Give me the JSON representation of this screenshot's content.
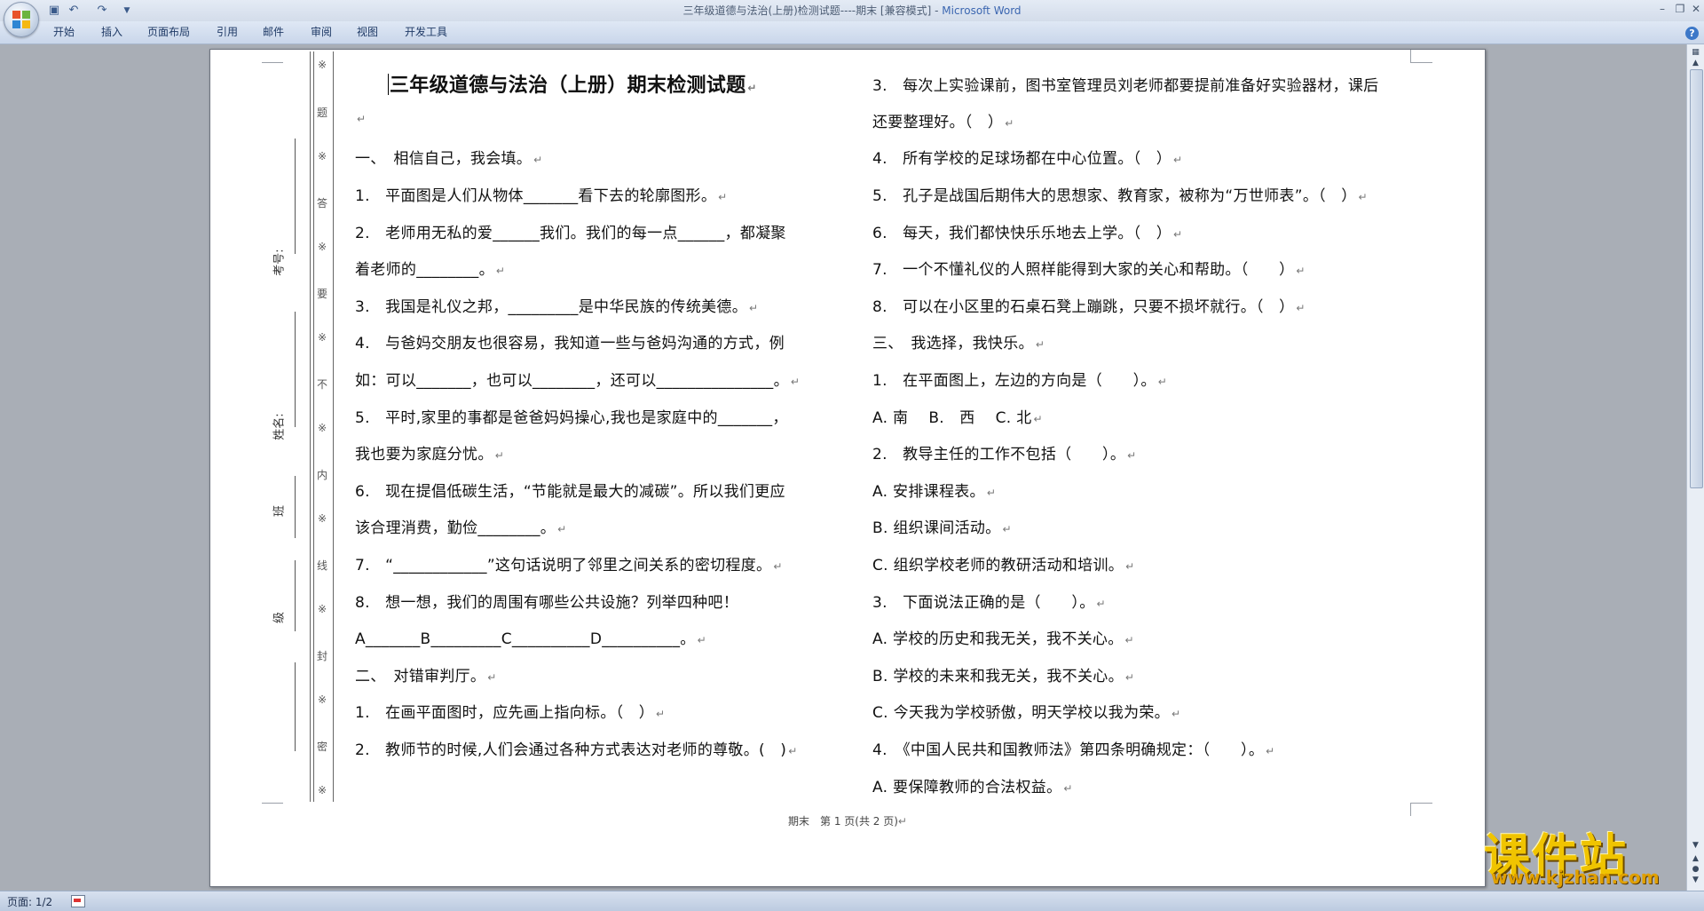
{
  "window": {
    "title": "三年级道德与法治(上册)检测试题----期末 [兼容模式] - ",
    "app_name": "Microsoft Word"
  },
  "quick_access": [
    "save-icon",
    "undo-icon",
    "redo-icon",
    "customize-icon"
  ],
  "ribbon": {
    "tabs": [
      "开始",
      "插入",
      "页面布局",
      "引用",
      "邮件",
      "审阅",
      "视图",
      "开发工具"
    ]
  },
  "binding_margin": {
    "chars": [
      "※",
      "题",
      "※",
      "答",
      "※",
      "要",
      "※",
      "不",
      "※",
      "内",
      "※",
      "线",
      "※",
      "封",
      "※",
      "密",
      "※"
    ],
    "labels": [
      "考号:",
      "姓名:",
      "班",
      "级"
    ]
  },
  "document": {
    "title": "三年级道德与法治（上册）期末检测试题",
    "left_column": [
      "",
      "一、　相信自己，我会填。",
      "1.　平面图是人们从物体_______看下去的轮廓图形。",
      "2.　老师用无私的爱______我们。我们的每一点______，都凝聚",
      "着老师的________。",
      "3.　我国是礼仪之邦，_________是中华民族的传统美德。",
      "4.　与爸妈交朋友也很容易，我知道一些与爸妈沟通的方式，例",
      "如：可以_______，也可以________，还可以_______________。",
      "5.　平时,家里的事都是爸爸妈妈操心,我也是家庭中的_______，",
      "我也要为家庭分忧。",
      "6.　现在提倡低碳生活，“节能就是最大的减碳”。所以我们更应",
      "该合理消费，勤俭________。",
      "7.　“____________”这句话说明了邻里之间关系的密切程度。",
      "8.　想一想，我们的周围有哪些公共设施？列举四种吧！",
      "A_______B_________C__________D__________。",
      "二、　对错审判厅。",
      "1.　在画平面图时，应先画上指向标。（　）",
      "2.　教师节的时候,人们会通过各种方式表达对老师的尊敬。(　)"
    ],
    "right_column": [
      "3.　每次上实验课前，图书室管理员刘老师都要提前准备好实验器材，课后",
      "还要整理好。（　）",
      "4.　所有学校的足球场都在中心位置。（　）",
      "5.　孔子是战国后期伟大的思想家、教育家，被称为“万世师表”。（　）",
      "6.　每天，我们都快快乐乐地去上学。（　）",
      "7.　一个不懂礼仪的人照样能得到大家的关心和帮助。（　　）",
      "8.　可以在小区里的石桌石凳上蹦跳，只要不损坏就行。（　）",
      "三、　我选择，我快乐。",
      "1.　在平面图上，左边的方向是（　　）。",
      "A. 南　 B.　西　  C. 北",
      "2.　教导主任的工作不包括（　　）。",
      "A. 安排课程表。",
      "B. 组织课间活动。",
      "C. 组织学校老师的教研活动和培训。",
      "3.　下面说法正确的是（　　）。",
      "A. 学校的历史和我无关，我不关心。",
      "B. 学校的未来和我无关，我不关心。",
      "C. 今天我为学校骄傲，明天学校以我为荣。",
      "4.　《中国人民共和国教师法》第四条明确规定：（　　）。",
      "A. 要保障教师的合法权益。"
    ],
    "paragraph_mark": "↵",
    "footer": "期末　第 1 页(共 2 页)"
  },
  "statusbar": {
    "page": "页面: 1/2"
  },
  "watermark": {
    "name": "课件站",
    "url": "www.kjzhan.com"
  },
  "colors": {
    "title_bar": "#dbe3ef",
    "workspace": "#a9aeb6",
    "page": "#ffffff",
    "app_name_accent": "#3b66b0"
  }
}
